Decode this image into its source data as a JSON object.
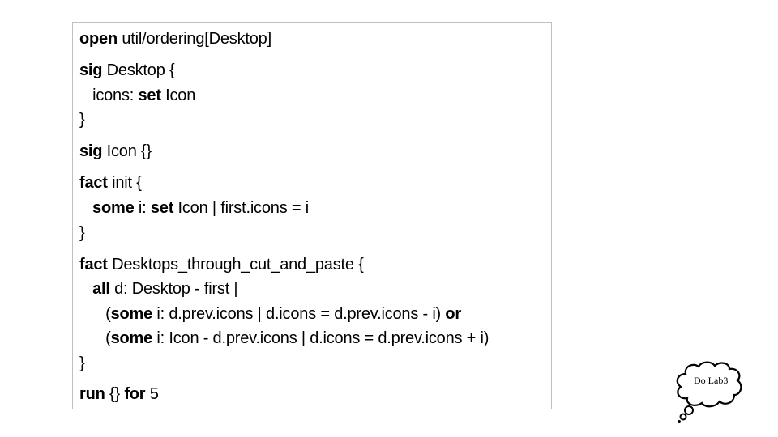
{
  "code_lines": [
    [
      {
        "t": "open",
        "b": true
      },
      {
        "t": " util/ordering[Desktop]",
        "b": false
      }
    ],
    [
      {
        "t": "sig",
        "b": true
      },
      {
        "t": " Desktop {",
        "b": false
      }
    ],
    [
      {
        "t": "   icons: ",
        "b": false
      },
      {
        "t": "set",
        "b": true
      },
      {
        "t": " Icon",
        "b": false
      }
    ],
    [
      {
        "t": "}",
        "b": false
      }
    ],
    [
      {
        "t": "sig",
        "b": true
      },
      {
        "t": " Icon {}",
        "b": false
      }
    ],
    [
      {
        "t": "fact",
        "b": true
      },
      {
        "t": " init {",
        "b": false
      }
    ],
    [
      {
        "t": "   ",
        "b": false
      },
      {
        "t": "some",
        "b": true
      },
      {
        "t": " i: ",
        "b": false
      },
      {
        "t": "set",
        "b": true
      },
      {
        "t": " Icon | first.icons = i",
        "b": false
      }
    ],
    [
      {
        "t": "}",
        "b": false
      }
    ],
    [
      {
        "t": "fact",
        "b": true
      },
      {
        "t": " Desktops_through_cut_and_paste {",
        "b": false
      }
    ],
    [
      {
        "t": "   ",
        "b": false
      },
      {
        "t": "all",
        "b": true
      },
      {
        "t": " d: Desktop - first |",
        "b": false
      }
    ],
    [
      {
        "t": "      (",
        "b": false
      },
      {
        "t": "some",
        "b": true
      },
      {
        "t": " i: d.prev.icons | d.icons = d.prev.icons - i) ",
        "b": false
      },
      {
        "t": "or",
        "b": true
      }
    ],
    [
      {
        "t": "      (",
        "b": false
      },
      {
        "t": "some",
        "b": true
      },
      {
        "t": " i: Icon - d.prev.icons | d.icons = d.prev.icons + i)",
        "b": false
      }
    ],
    [
      {
        "t": "}",
        "b": false
      }
    ],
    [
      {
        "t": "run",
        "b": true
      },
      {
        "t": " {} ",
        "b": false
      },
      {
        "t": "for",
        "b": true
      },
      {
        "t": " 5",
        "b": false
      }
    ]
  ],
  "thought_bubble": {
    "text": "Do Lab3"
  },
  "colors": {
    "box_border": "#bfbfbf",
    "text": "#000000",
    "background": "#ffffff"
  }
}
